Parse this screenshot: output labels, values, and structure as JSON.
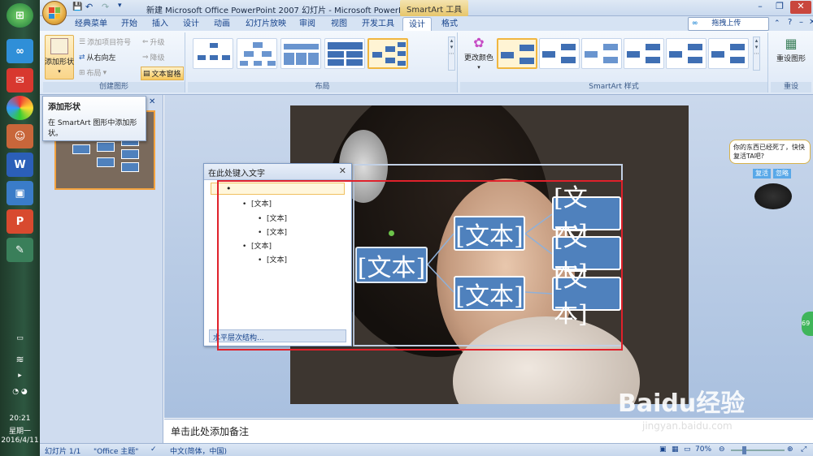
{
  "window": {
    "title": "新建 Microsoft Office PowerPoint 2007 幻灯片 - Microsoft PowerPoi...",
    "context_tab": "SmartArt 工具"
  },
  "quick_access": {
    "save_icon": "save-icon",
    "undo_icon": "undo-icon",
    "redo_icon": "redo-icon"
  },
  "tabs": [
    "经典菜单",
    "开始",
    "插入",
    "设计",
    "动画",
    "幻灯片放映",
    "审阅",
    "视图",
    "开发工具",
    "设计",
    "格式"
  ],
  "active_tab_index": 9,
  "upload_button": "拖拽上传",
  "ribbon": {
    "create_graphic": {
      "label": "创建图形",
      "add_shape": "添加形状",
      "add_bullet": "添加项目符号",
      "right_to_left": "从右向左",
      "layout": "布局",
      "promote": "升级",
      "demote": "降级",
      "text_pane": "文本窗格"
    },
    "layouts": {
      "label": "布局"
    },
    "styles": {
      "label": "SmartArt 样式",
      "change_colors": "更改颜色"
    },
    "reset": {
      "label": "重设",
      "reset_graphic": "重设图形"
    }
  },
  "tooltip": {
    "title": "添加形状",
    "body": "在 SmartArt 图形中添加形状。"
  },
  "text_pane": {
    "title": "在此处键入文字",
    "items": [
      {
        "level": 1,
        "text": ""
      },
      {
        "level": 2,
        "text": "[文本]"
      },
      {
        "level": 3,
        "text": "[文本]"
      },
      {
        "level": 3,
        "text": "[文本]"
      },
      {
        "level": 2,
        "text": "[文本]"
      },
      {
        "level": 3,
        "text": "[文本]"
      }
    ],
    "footer": "水平层次结构..."
  },
  "smartart_nodes": [
    "[文本]",
    "[文本]",
    "[文本]",
    "[文本]",
    "[文本]",
    "[文本]"
  ],
  "notes_placeholder": "单击此处添加备注",
  "status": {
    "slide": "幻灯片 1/1",
    "theme": "\"Office 主题\"",
    "language": "中文(简体，中国)",
    "zoom": "70%"
  },
  "side_popup": {
    "text": "你的东西已经死了，快快复活TA吧?",
    "btn1": "复活",
    "btn2": "忽略"
  },
  "taskbar": {
    "time": "20:21",
    "weekday": "星期一",
    "date": "2016/4/11"
  },
  "watermark": {
    "brand": "Baidu经验",
    "url": "jingyan.baidu.com"
  },
  "colors": {
    "ribbon_accent": "#15428b",
    "node_fill": "#4f81bd",
    "highlight_box": "#e0212b"
  }
}
